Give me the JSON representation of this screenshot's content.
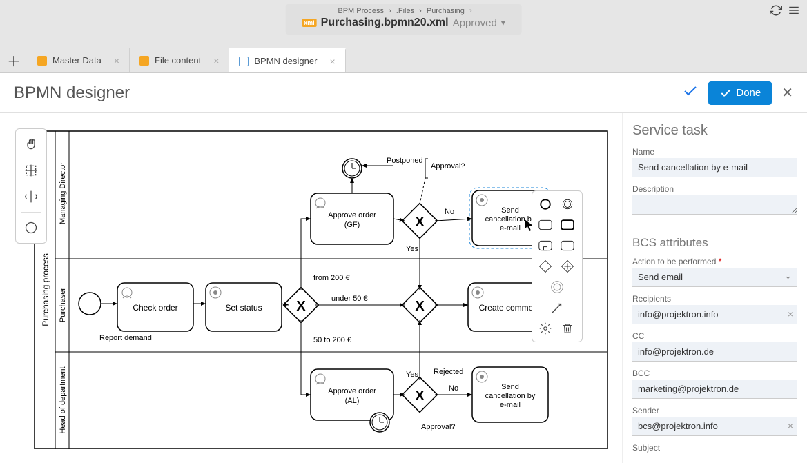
{
  "breadcrumb": {
    "a": "BPM Process",
    "b": ".Files",
    "c": "Purchasing"
  },
  "file": {
    "name": "Purchasing.bpmn20.xml",
    "status": "Approved"
  },
  "tabs": [
    {
      "label": "Master Data"
    },
    {
      "label": "File content"
    },
    {
      "label": "BPMN designer"
    }
  ],
  "page_title": "BPMN designer",
  "done_label": "Done",
  "diagram": {
    "pool": "Purchasing process",
    "lanes": [
      "Managing Director",
      "Purchaser",
      "Head of department"
    ],
    "tasks": {
      "approve_gf": "Approve order (GF)",
      "check_order": "Check order",
      "set_status": "Set status",
      "create_comment": "Create comment",
      "approve_al": "Approve order (AL)",
      "send_cancel_1": "Send cancellation by e-mail",
      "send_cancel_2": "Send cancellation by e-mail"
    },
    "labels": {
      "postponed": "Postponed",
      "approval_q1": "Approval?",
      "approval_q2": "Approval?",
      "no1": "No",
      "yes1": "Yes",
      "no2": "No",
      "yes2": "Yes",
      "rejected": "Rejected",
      "from200": "from 200 €",
      "under50": "under 50 €",
      "fifty200": "50 to 200 €",
      "report_demand": "Report demand"
    }
  },
  "panel": {
    "title": "Service task",
    "name_label": "Name",
    "name_value": "Send cancellation by e-mail",
    "desc_label": "Description",
    "desc_value": "",
    "bcs_title": "BCS attributes",
    "action_label": "Action to be performed",
    "action_value": "Send email",
    "recipients_label": "Recipients",
    "recipients_value": "info@projektron.info",
    "cc_label": "CC",
    "cc_value": "info@projektron.de",
    "bcc_label": "BCC",
    "bcc_value": "marketing@projektron.de",
    "sender_label": "Sender",
    "sender_value": "bcs@projektron.info",
    "subject_label": "Subject"
  }
}
